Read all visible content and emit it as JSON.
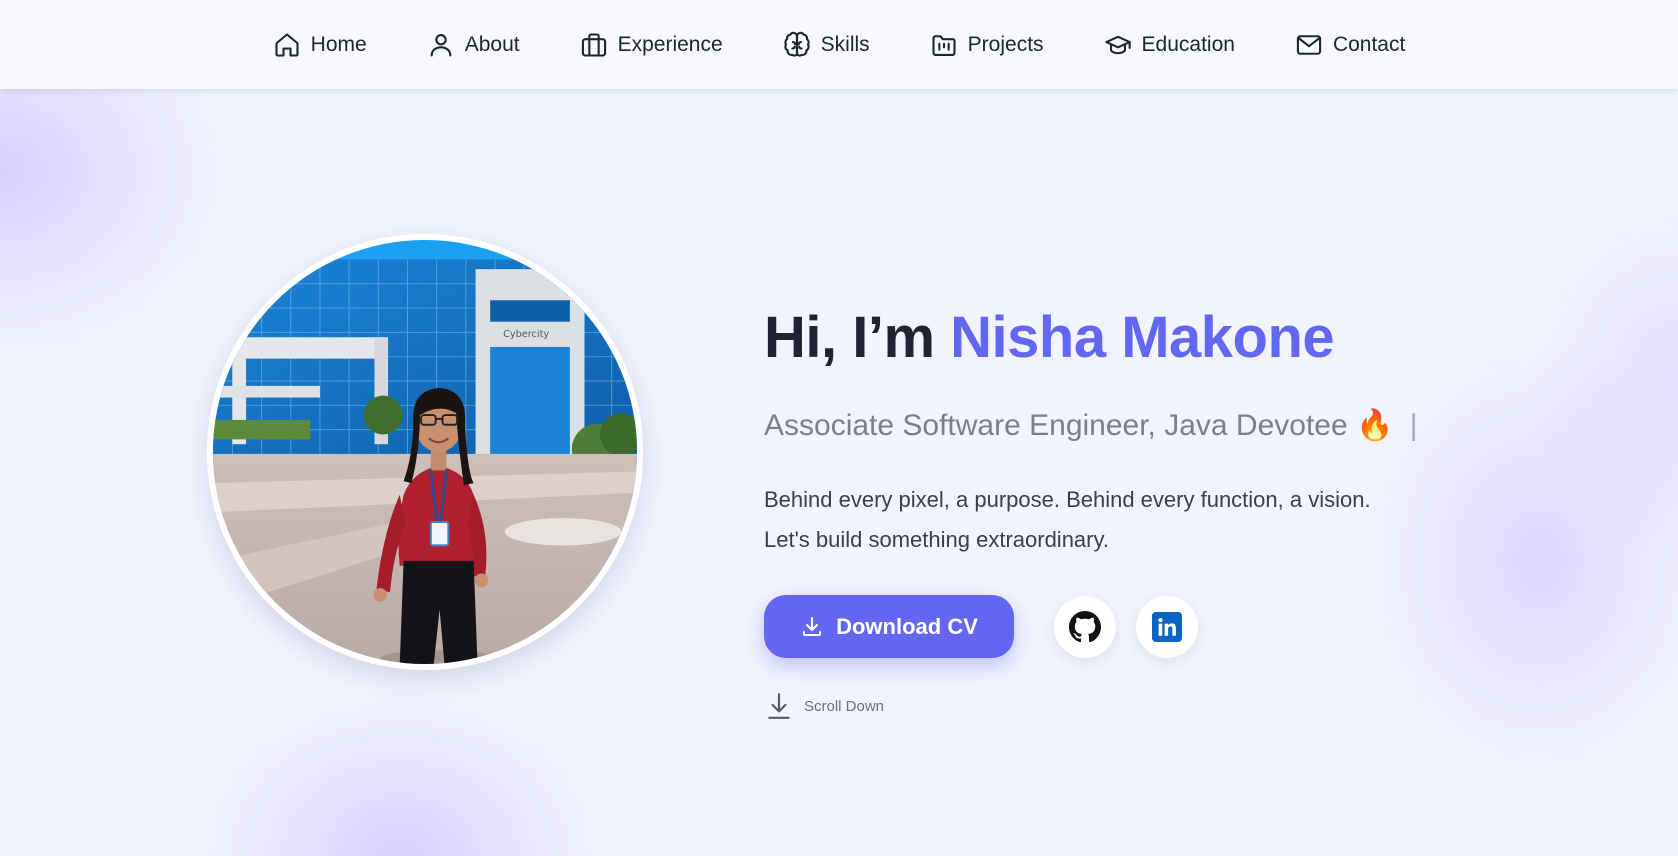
{
  "nav": {
    "items": [
      {
        "label": "Home",
        "icon": "home-icon"
      },
      {
        "label": "About",
        "icon": "user-icon"
      },
      {
        "label": "Experience",
        "icon": "briefcase-icon"
      },
      {
        "label": "Skills",
        "icon": "brain-icon"
      },
      {
        "label": "Projects",
        "icon": "folder-icon"
      },
      {
        "label": "Education",
        "icon": "graduation-cap-icon"
      },
      {
        "label": "Contact",
        "icon": "mail-icon"
      }
    ]
  },
  "hero": {
    "greeting": "Hi, I’m",
    "name": "Nisha Makone",
    "subtitle": "Associate Software Engineer, Java Devotee",
    "subtitle_emoji": "🔥",
    "cursor": "|",
    "description": "Behind every pixel, a purpose. Behind every function, a vision. Let's build something extraordinary.",
    "cv_button": "Download CV",
    "scroll_label": "Scroll Down",
    "photo_sign_text": "Cybercity"
  },
  "social": [
    {
      "name": "github",
      "icon": "github-icon"
    },
    {
      "name": "linkedin",
      "icon": "linkedin-icon"
    }
  ],
  "colors": {
    "accent": "#6366f1",
    "text": "#1f2430",
    "muted": "#7a7f8e",
    "linkedin": "#0a66c2"
  }
}
